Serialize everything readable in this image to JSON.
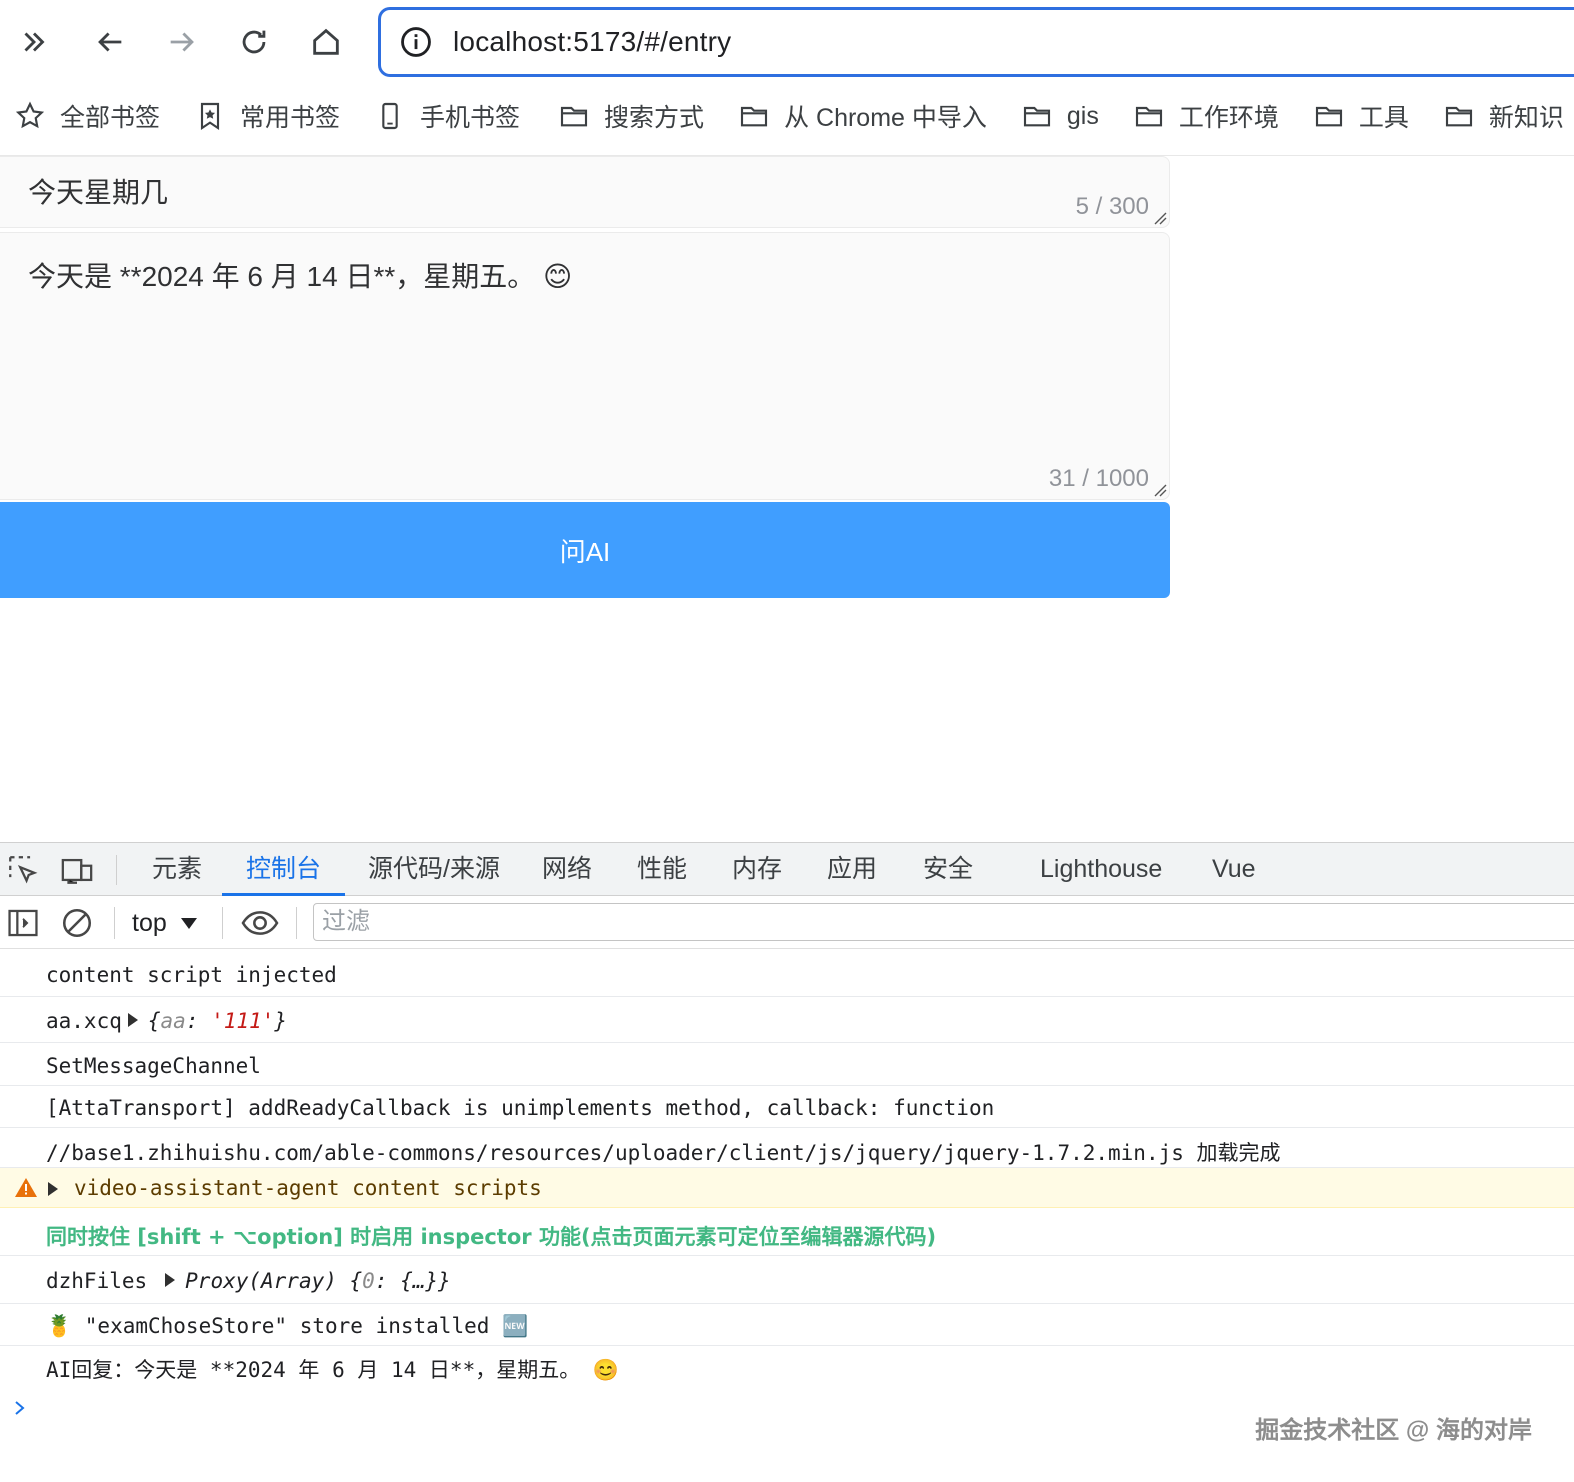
{
  "browser": {
    "url": "localhost:5173/#/entry",
    "bookmarks": [
      {
        "label": "全部书签",
        "icon": "star-icon"
      },
      {
        "label": "常用书签",
        "icon": "bookmark-icon"
      },
      {
        "label": "手机书签",
        "icon": "phone-icon"
      },
      {
        "label": "搜索方式",
        "icon": "folder-icon"
      },
      {
        "label": "从 Chrome 中导入",
        "icon": "folder-icon"
      },
      {
        "label": "gis",
        "icon": "folder-icon"
      },
      {
        "label": "工作环境",
        "icon": "folder-icon"
      },
      {
        "label": "工具",
        "icon": "folder-icon"
      },
      {
        "label": "新知识",
        "icon": "folder-icon"
      }
    ]
  },
  "page": {
    "question": {
      "value": "今天星期几",
      "count": "5 / 300"
    },
    "answer": {
      "value": "今天是 **2024 年 6 月 14 日**，星期五。 😊",
      "count": "31 / 1000"
    },
    "ask_button": "问AI"
  },
  "devtools": {
    "tabs": [
      "元素",
      "控制台",
      "源代码/来源",
      "网络",
      "性能",
      "内存",
      "应用",
      "安全",
      "Lighthouse",
      "Vue"
    ],
    "active_tab": "控制台",
    "context": "top",
    "filter_placeholder": "过滤",
    "console": {
      "line1": "content script injected",
      "line2_label": "aa.xcq",
      "line2_key": "aa",
      "line2_val": "'111'",
      "line3": "SetMessageChannel",
      "line4": "[AttaTransport] addReadyCallback is unimplements method, callback: function",
      "line5": "//base1.zhihuishu.com/able-commons/resources/uploader/client/js/jquery/jquery-1.7.2.min.js 加载完成",
      "line6": "video-assistant-agent content scripts",
      "line7": "同时按住 [shift + ⌥option] 时启用 inspector 功能(点击页面元素可定位至编辑器源代码)",
      "line8_label": "dzhFiles",
      "line8_proxy": "Proxy(Array)",
      "line8_key": "0",
      "line9": "🍍 \"examChoseStore\" store installed 🆕",
      "line10": "AI回复：今天是 **2024 年 6 月 14 日**，星期五。 😊"
    }
  },
  "watermark": "掘金技术社区 @ 海的对岸",
  "colors": {
    "accent": "#1a73e8",
    "button": "#409eff",
    "warning_bg": "#fffbe5",
    "vue_green": "#42b883"
  }
}
